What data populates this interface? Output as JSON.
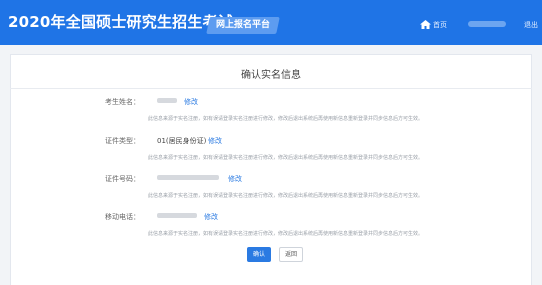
{
  "header": {
    "site_title": "2020年全国硕士研究生招生考试",
    "platform_label": "网上报名平台",
    "home_icon": "home-icon",
    "home_label": "首页",
    "logout_label": "退出",
    "brand_color": "#1f74e6"
  },
  "page": {
    "title": "确认实名信息"
  },
  "fields": [
    {
      "label": "考生姓名：",
      "value": "",
      "edit_label": "修改",
      "hint": "此信息来源于实名注册，如有误请登录实名注册进行修改，修改后退出系统后再使用新信息重新登录并同步信息后方可生效。"
    },
    {
      "label": "证件类型：",
      "value": "01(居民身份证)",
      "edit_label": "修改",
      "hint": "此信息来源于实名注册，如有误请登录实名注册进行修改，修改后退出系统后再使用新信息重新登录并同步信息后方可生效。"
    },
    {
      "label": "证件号码：",
      "value": "",
      "edit_label": "修改",
      "hint": "此信息来源于实名注册，如有误请登录实名注册进行修改，修改后退出系统后再使用新信息重新登录并同步信息后方可生效。"
    },
    {
      "label": "移动电话：",
      "value": "",
      "edit_label": "修改",
      "hint": "此信息来源于实名注册，如有误请登录实名注册进行修改，修改后退出系统后再使用新信息重新登录并同步信息后方可生效。"
    }
  ],
  "actions": {
    "confirm_label": "确认",
    "back_label": "返回",
    "accent_color": "#2a7ae2"
  }
}
